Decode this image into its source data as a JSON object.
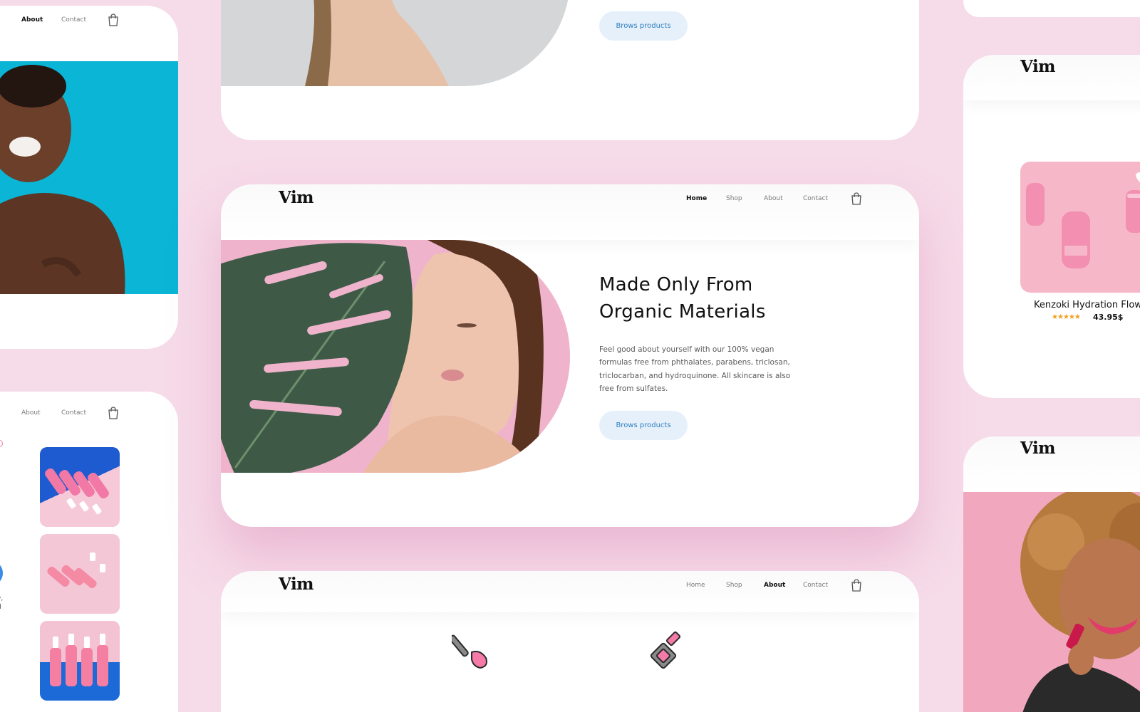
{
  "brand": {
    "logo": "Vim"
  },
  "nav": {
    "home": "Home",
    "shop": "Shop",
    "about": "About",
    "contact": "Contact"
  },
  "hero": {
    "title_line1": "Made Only From",
    "title_line2": "Organic Materials",
    "body": "Feel good about yourself with our 100% vegan formulas free from phthalates, parabens, triclosan, triclocarban, and hydroquinone. All skincare is also free from sulfates.",
    "cta": "Brows products"
  },
  "top_card": {
    "cta": "Brows products"
  },
  "product": {
    "name": "Kenzoki Hydration Flow",
    "price": "43.95$",
    "rating": 5
  },
  "left_bottom": {
    "snippet_line1": "y,",
    "snippet_line2": "d"
  },
  "colors": {
    "background": "#f6dbe9",
    "accent_pink": "#f3a6c8",
    "button_bg": "#e6f0fb",
    "button_text": "#2d7fc0",
    "star": "#f4a021"
  },
  "icons": [
    "bag-icon",
    "heart-icon",
    "star-icon",
    "makeup-brush-icon",
    "nail-polish-icon"
  ]
}
